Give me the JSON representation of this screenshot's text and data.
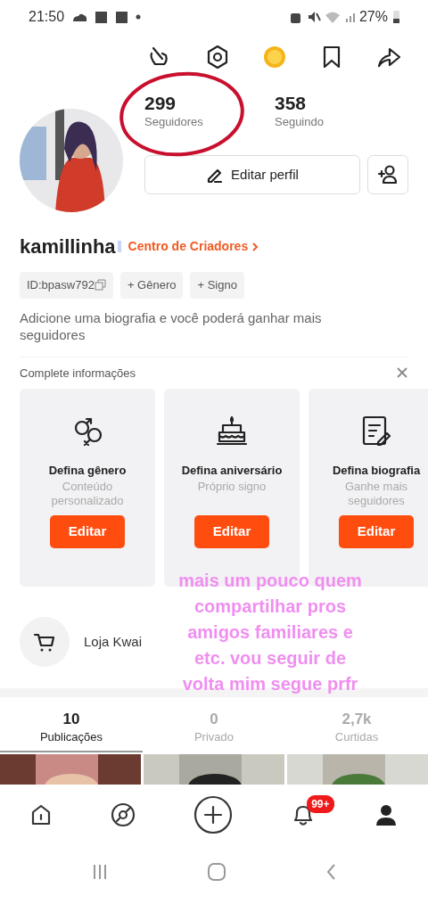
{
  "status_bar": {
    "time": "21:50",
    "battery": "27%"
  },
  "stats": [
    {
      "value": "299",
      "label": "Seguidores",
      "annotated": true
    },
    {
      "value": "358",
      "label": "Seguindo",
      "annotated": false
    }
  ],
  "edit_button": "Editar perfil",
  "username": "kamillinha",
  "creator_link": "Centro de Criadores",
  "chips": [
    {
      "kind": "id",
      "label": "ID:bpasw792"
    },
    {
      "kind": "add",
      "label": "+ Gênero"
    },
    {
      "kind": "add",
      "label": "+ Signo"
    }
  ],
  "bio_hint": "Adicione uma biografia e você poderá ganhar mais seguidores",
  "complete_section": {
    "title": "Complete informações",
    "cards": [
      {
        "kind": "gender",
        "title": "Defina gênero",
        "subtitle": "Conteúdo personalizado",
        "button": "Editar"
      },
      {
        "kind": "birthday",
        "title": "Defina aniversário",
        "subtitle": "Próprio signo",
        "button": "Editar"
      },
      {
        "kind": "bio",
        "title": "Defina biografia",
        "subtitle": "Ganhe mais seguidores",
        "button": "Editar"
      }
    ]
  },
  "shop": {
    "label": "Loja Kwai"
  },
  "overlay_caption": "mais um pouco quem compartilhar pros amigos familiares e etc. vou seguir de volta mim segue prfr",
  "content_tabs": [
    {
      "value": "10",
      "label": "Publicações",
      "selected": true
    },
    {
      "value": "0",
      "label": "Privado",
      "selected": false
    },
    {
      "value": "2,7k",
      "label": "Curtidas",
      "selected": false
    }
  ],
  "bottom_nav": [
    {
      "kind": "home",
      "selected": false
    },
    {
      "kind": "discover",
      "selected": false
    },
    {
      "kind": "create",
      "selected": false
    },
    {
      "kind": "notifications",
      "selected": false,
      "badge": "99+"
    },
    {
      "kind": "profile",
      "selected": true
    }
  ]
}
